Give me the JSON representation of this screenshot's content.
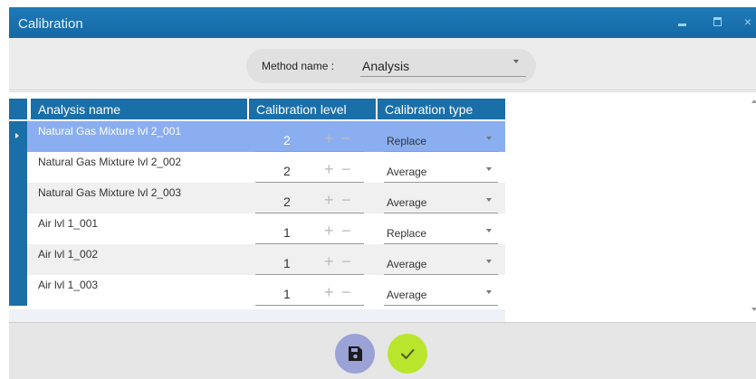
{
  "window": {
    "title": "Calibration",
    "min_icon": "minimize-icon",
    "max_icon": "maximize-icon",
    "close_glyph": "×"
  },
  "method": {
    "label": "Method name :",
    "value": "Analysis"
  },
  "table": {
    "columns": [
      "Analysis name",
      "Calibration level",
      "Calibration type"
    ],
    "rows": [
      {
        "name": "Natural Gas Mixture lvl 2_001",
        "level": "2",
        "type": "Replace",
        "selected": true
      },
      {
        "name": "Natural Gas Mixture lvl 2_002",
        "level": "2",
        "type": "Average",
        "selected": false
      },
      {
        "name": "Natural Gas Mixture lvl 2_003",
        "level": "2",
        "type": "Average",
        "selected": false
      },
      {
        "name": "Air lvl 1_001",
        "level": "1",
        "type": "Replace",
        "selected": false
      },
      {
        "name": "Air lvl 1_002",
        "level": "1",
        "type": "Average",
        "selected": false
      },
      {
        "name": "Air lvl 1_003",
        "level": "1",
        "type": "Average",
        "selected": false
      }
    ],
    "plus_glyph": "+",
    "minus_glyph": "−"
  },
  "buttons": {
    "save_icon": "save-icon",
    "confirm_icon": "checkmark-icon"
  },
  "colors": {
    "accent": "#1a6fa9",
    "selected_row": "#8aaef0",
    "save_button": "#9aa2d6",
    "confirm_button": "#b9e62c"
  }
}
